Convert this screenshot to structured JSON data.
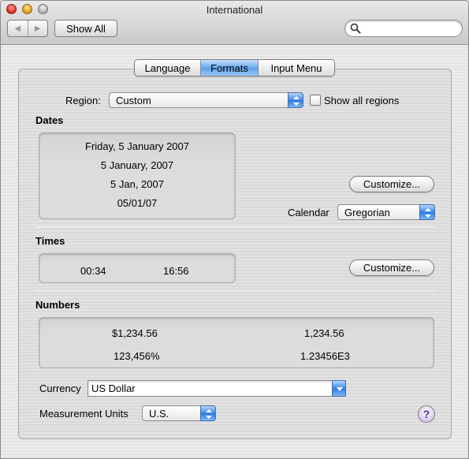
{
  "window": {
    "title": "International"
  },
  "toolbar": {
    "back_glyph": "◀",
    "forward_glyph": "▶",
    "show_all_label": "Show All",
    "search_value": "",
    "search_placeholder": ""
  },
  "tabs": [
    {
      "label": "Language",
      "selected": false
    },
    {
      "label": "Formats",
      "selected": true
    },
    {
      "label": "Input Menu",
      "selected": false
    }
  ],
  "region": {
    "label": "Region:",
    "value": "Custom",
    "show_all_label": "Show all regions",
    "show_all_checked": false
  },
  "dates": {
    "heading": "Dates",
    "samples": [
      "Friday, 5 January 2007",
      "5 January, 2007",
      "5 Jan, 2007",
      "05/01/07"
    ],
    "customize_label": "Customize...",
    "calendar_label": "Calendar",
    "calendar_value": "Gregorian"
  },
  "times": {
    "heading": "Times",
    "samples": [
      "00:34",
      "16:56"
    ],
    "customize_label": "Customize..."
  },
  "numbers": {
    "heading": "Numbers",
    "samples": [
      "$1,234.56",
      "1,234.56",
      "123,456%",
      "1.23456E3"
    ]
  },
  "currency": {
    "label": "Currency",
    "value": "US Dollar"
  },
  "measurement": {
    "label": "Measurement Units",
    "value": "U.S."
  },
  "help": {
    "glyph": "?"
  },
  "colors": {
    "accent_blue": "#3a87ea",
    "close_red": "#d2291c",
    "minimize_yellow": "#d79a12",
    "help_purple": "#5a2a9a"
  },
  "icons": [
    "close-icon",
    "minimize-icon",
    "zoom-icon",
    "back-arrow-icon",
    "forward-arrow-icon",
    "search-icon",
    "popup-arrows-icon",
    "help-icon"
  ]
}
